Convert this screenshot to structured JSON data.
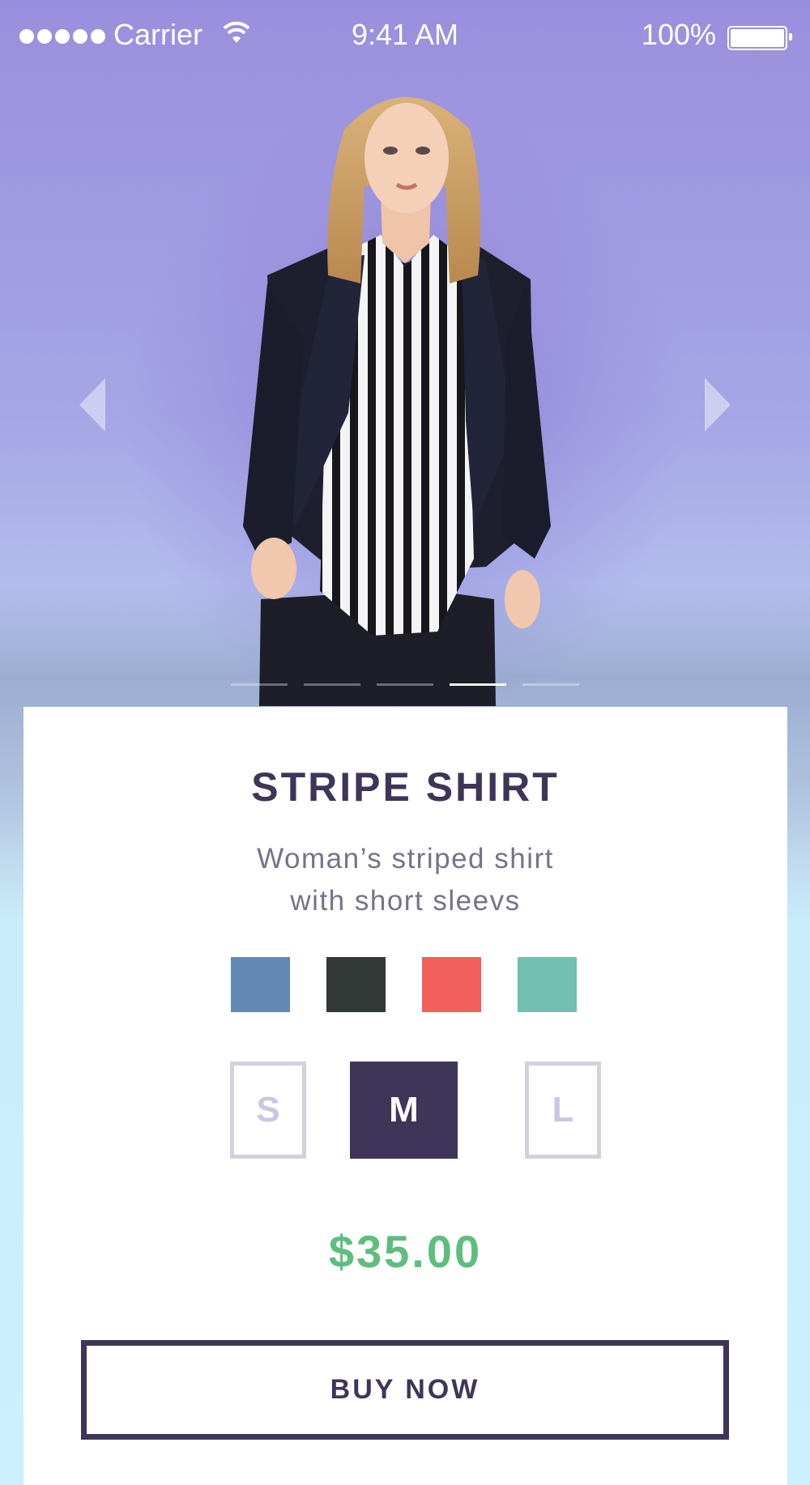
{
  "status_bar": {
    "carrier": "Carrier",
    "time": "9:41 AM",
    "battery": "100%",
    "signal_bars": 5
  },
  "hero": {
    "slide_count": 5,
    "active_slide": 4,
    "prev_icon": "chevron-left-icon",
    "next_icon": "chevron-right-icon"
  },
  "product": {
    "name": "STRIPE SHIRT",
    "description_line1": "Woman’s striped shirt",
    "description_line2": "with short sleevs",
    "colors": [
      "#6388b3",
      "#323836",
      "#f35f5b",
      "#71bfb0"
    ],
    "sizes": [
      "S",
      "M",
      "L"
    ],
    "selected_size": "M",
    "price": "$35.00",
    "buy_label": "BUY NOW"
  },
  "theme": {
    "accent": "#3f3558",
    "price_green": "#5fbd7e",
    "inactive_size": "#cbc6e2"
  }
}
